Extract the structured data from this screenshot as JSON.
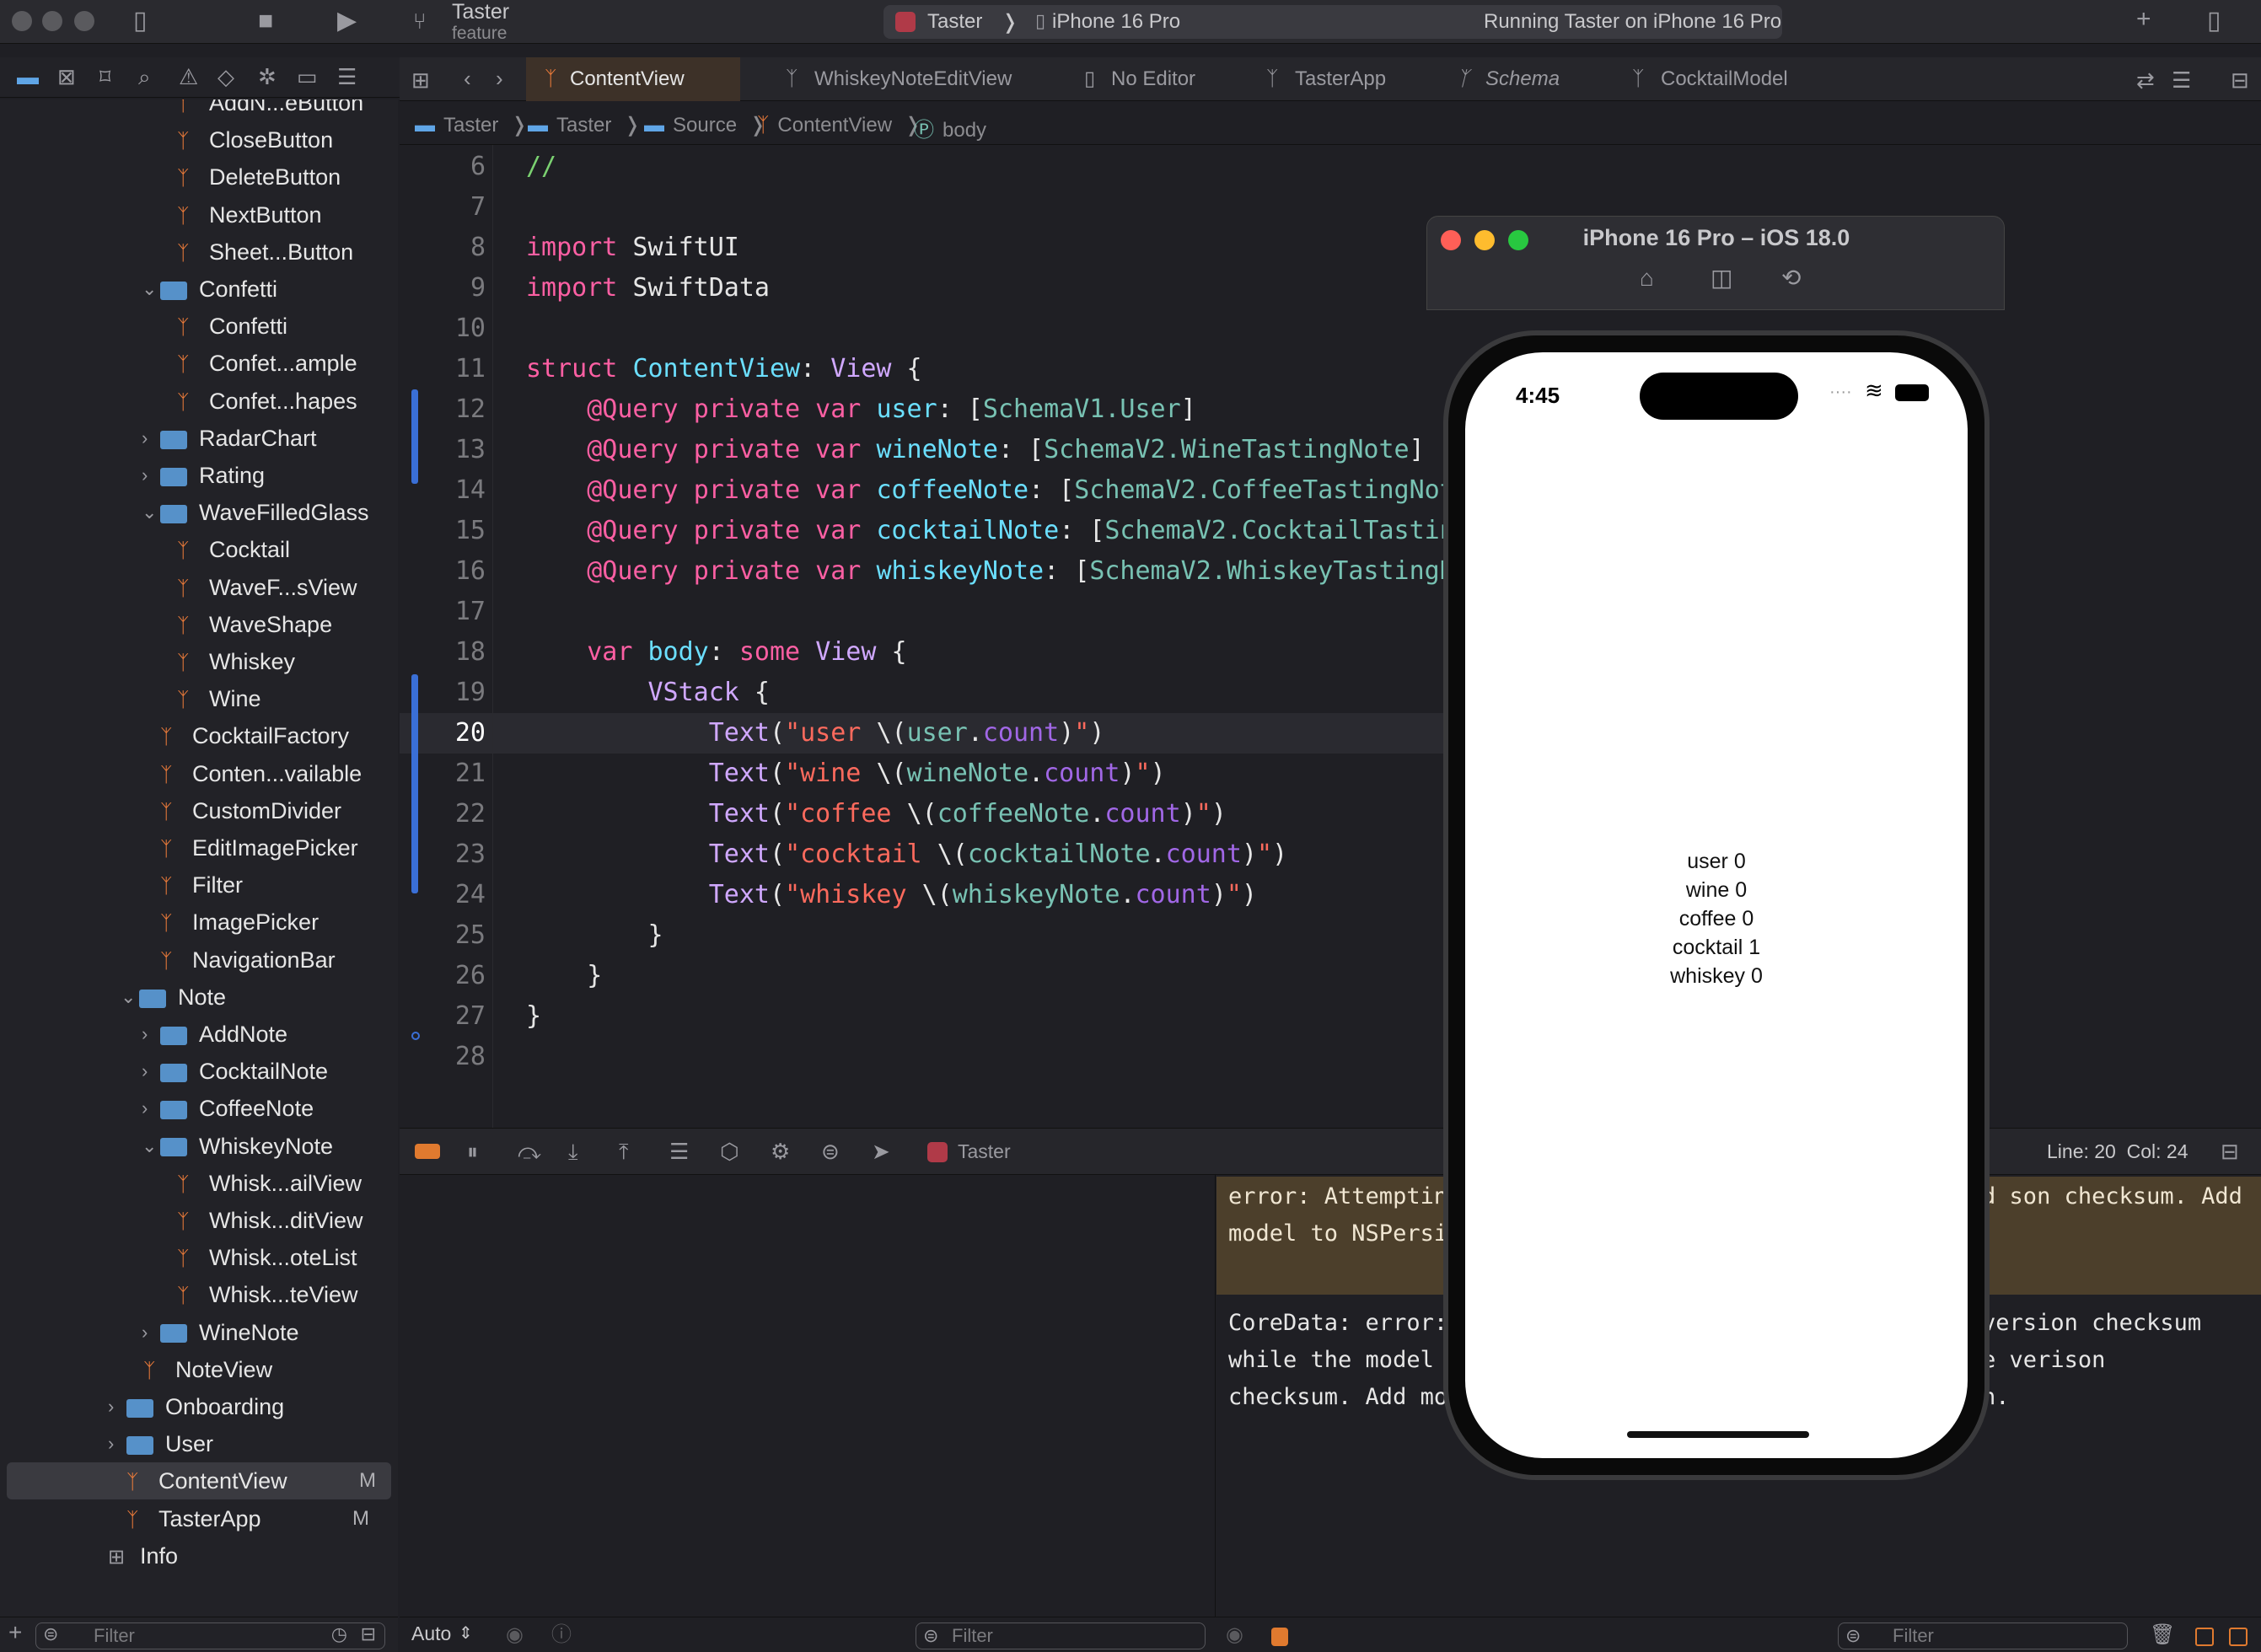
{
  "toolbar": {
    "branch_title": "Taster",
    "branch_sub": "feature",
    "scheme": "Taster",
    "destination": "iPhone 16 Pro",
    "status": "Running Taster on iPhone 16 Pro"
  },
  "tabs": [
    {
      "label": "ContentView"
    },
    {
      "label": "WhiskeyNoteEditView"
    },
    {
      "label": "No Editor"
    },
    {
      "label": "TasterApp"
    },
    {
      "label": "Schema"
    },
    {
      "label": "CocktailModel"
    }
  ],
  "breadcrumb": [
    "Taster",
    "Taster",
    "Source",
    "ContentView",
    "body"
  ],
  "sidebar": {
    "items": [
      {
        "label": "AddN...eButton",
        "kind": "swift"
      },
      {
        "label": "CloseButton",
        "kind": "swift"
      },
      {
        "label": "DeleteButton",
        "kind": "swift"
      },
      {
        "label": "NextButton",
        "kind": "swift"
      },
      {
        "label": "Sheet...Button",
        "kind": "swift"
      },
      {
        "label": "Confetti",
        "kind": "folder-open"
      },
      {
        "label": "Confetti",
        "kind": "swift"
      },
      {
        "label": "Confet...ample",
        "kind": "swift"
      },
      {
        "label": "Confet...hapes",
        "kind": "swift"
      },
      {
        "label": "RadarChart",
        "kind": "folder"
      },
      {
        "label": "Rating",
        "kind": "folder"
      },
      {
        "label": "WaveFilledGlass",
        "kind": "folder-open"
      },
      {
        "label": "Cocktail",
        "kind": "swift"
      },
      {
        "label": "WaveF...sView",
        "kind": "swift"
      },
      {
        "label": "WaveShape",
        "kind": "swift"
      },
      {
        "label": "Whiskey",
        "kind": "swift"
      },
      {
        "label": "Wine",
        "kind": "swift"
      },
      {
        "label": "CocktailFactory",
        "kind": "swift"
      },
      {
        "label": "Conten...vailable",
        "kind": "swift"
      },
      {
        "label": "CustomDivider",
        "kind": "swift"
      },
      {
        "label": "EditImagePicker",
        "kind": "swift"
      },
      {
        "label": "Filter",
        "kind": "swift"
      },
      {
        "label": "ImagePicker",
        "kind": "swift"
      },
      {
        "label": "NavigationBar",
        "kind": "swift"
      },
      {
        "label": "Note",
        "kind": "folder-open"
      },
      {
        "label": "AddNote",
        "kind": "folder"
      },
      {
        "label": "CocktailNote",
        "kind": "folder"
      },
      {
        "label": "CoffeeNote",
        "kind": "folder"
      },
      {
        "label": "WhiskeyNote",
        "kind": "folder-open"
      },
      {
        "label": "Whisk...ailView",
        "kind": "swift"
      },
      {
        "label": "Whisk...ditView",
        "kind": "swift"
      },
      {
        "label": "Whisk...oteList",
        "kind": "swift"
      },
      {
        "label": "Whisk...teView",
        "kind": "swift"
      },
      {
        "label": "WineNote",
        "kind": "folder"
      },
      {
        "label": "NoteView",
        "kind": "swift"
      },
      {
        "label": "Onboarding",
        "kind": "folder"
      },
      {
        "label": "User",
        "kind": "folder"
      },
      {
        "label": "ContentView",
        "kind": "swift",
        "flag": "M"
      },
      {
        "label": "TasterApp",
        "kind": "swift",
        "flag": "M"
      },
      {
        "label": "Info",
        "kind": "table"
      }
    ],
    "filter_placeholder": "Filter"
  },
  "editor": {
    "line_numbers": [
      "6",
      "7",
      "8",
      "9",
      "10",
      "11",
      "12",
      "13",
      "14",
      "15",
      "16",
      "17",
      "18",
      "19",
      "20",
      "21",
      "22",
      "23",
      "24",
      "25",
      "26",
      "27",
      "28"
    ],
    "current_line": "20"
  },
  "debug": {
    "process": "Taster",
    "position": "Line: 20  Col: 24"
  },
  "console": {
    "error1": "error: Attempting                                         n checksum while the model is still ed                                  son checksum. Add model to NSPersis",
    "log_lines": [
      "CoreData: error:                                   del version checksum",
      "while the model i                                  table verison",
      "checksum. Add mod                                  again."
    ],
    "auto_label": "Auto",
    "filter_placeholder": "Filter"
  },
  "simulator": {
    "title": "iPhone 16 Pro – iOS 18.0",
    "time": "4:45",
    "lines": [
      "user 0",
      "wine 0",
      "coffee 0",
      "cocktail 1",
      "whiskey 0"
    ]
  }
}
